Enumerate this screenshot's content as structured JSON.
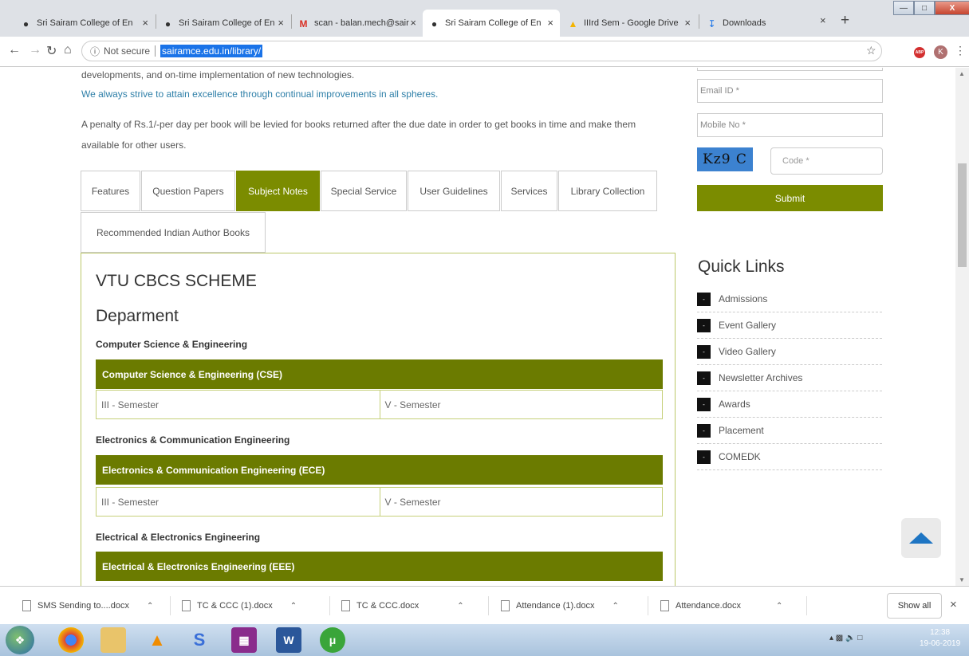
{
  "browser": {
    "tabs": [
      {
        "title": "Sri Sairam College of En",
        "icon": "globe-icon"
      },
      {
        "title": "Sri Sairam College of En",
        "icon": "globe-icon"
      },
      {
        "title": "scan - balan.mech@sair",
        "icon": "gmail-icon"
      },
      {
        "title": "Sri Sairam College of En",
        "icon": "globe-icon",
        "active": true
      },
      {
        "title": "IIIrd Sem - Google Drive",
        "icon": "drive-icon"
      },
      {
        "title": "Downloads",
        "icon": "download-icon"
      }
    ],
    "security_label": "Not secure",
    "url": "sairamce.edu.in/library/",
    "profile_initial": "K",
    "adblock_label": "ABP"
  },
  "intro": {
    "line1": "developments, and on-time implementation of new technologies.",
    "line2": "We always strive to attain excellence through continual improvements in all spheres.",
    "penalty_line1": "A penalty of Rs.1/-per day per book will be levied for books returned after the due date in order to get books in time and make them",
    "penalty_line2": "available for other users."
  },
  "page_tabs": [
    "Features",
    "Question Papers",
    "Subject Notes",
    "Special Service",
    "User Guidelines",
    "Services",
    "Library Collection",
    "Recommended Indian Author Books"
  ],
  "active_tab": "Subject Notes",
  "panel": {
    "heading": "VTU CBCS SCHEME",
    "subheading": "Deparment",
    "departments": [
      {
        "title": "Computer Science & Engineering",
        "bar": "Computer Science & Engineering (CSE)",
        "semesters": [
          "III - Semester",
          "V - Semester"
        ]
      },
      {
        "title": "Electronics & Communication Engineering",
        "bar": "Electronics & Communication Engineering (ECE)",
        "semesters": [
          "III - Semester",
          "V - Semester"
        ]
      },
      {
        "title": "Electrical & Electronics Engineering",
        "bar": "Electrical & Electronics Engineering (EEE)"
      }
    ]
  },
  "form": {
    "email_placeholder": "Email ID *",
    "mobile_placeholder": "Mobile No *",
    "captcha_text": "Kz9 C",
    "code_placeholder": "Code *",
    "submit_label": "Submit"
  },
  "quick_links": {
    "title": "Quick Links",
    "items": [
      "Admissions",
      "Event Gallery",
      "Video Gallery",
      "Newsletter Archives",
      "Awards",
      "Placement",
      "COMEDK"
    ]
  },
  "downloads": {
    "items": [
      "SMS Sending to....docx",
      "TC & CCC (1).docx",
      "TC & CCC.docx",
      "Attendance (1).docx",
      "Attendance.docx"
    ],
    "show_all": "Show all"
  },
  "taskbar": {
    "time": "12:38",
    "date": "19-06-2019"
  },
  "colors": {
    "accent": "#7b8c00",
    "dept_bar": "#6b7b00",
    "link_blue": "#2e7fa8"
  }
}
